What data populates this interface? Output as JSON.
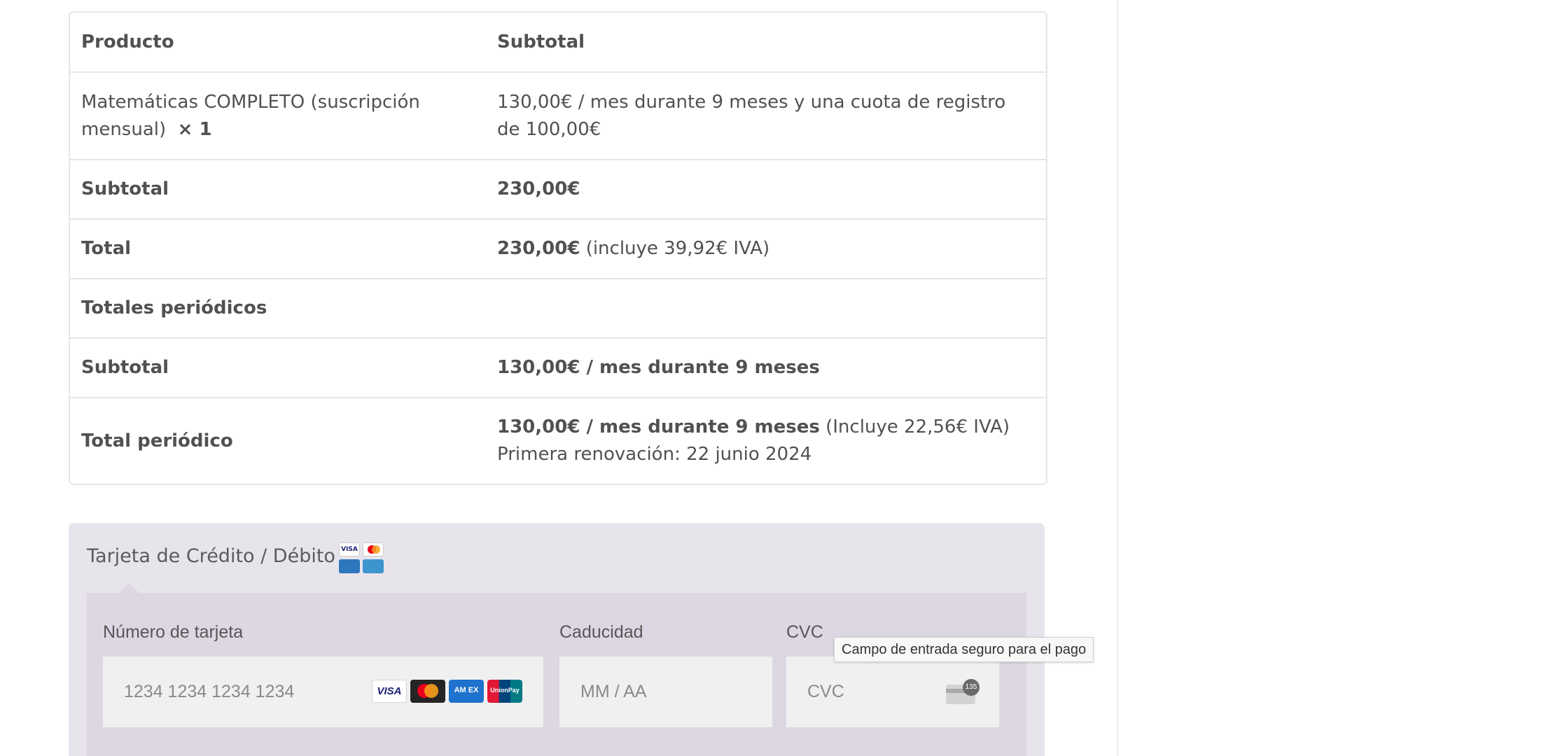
{
  "order": {
    "header": {
      "product": "Producto",
      "subtotal": "Subtotal"
    },
    "item": {
      "name": "Matemáticas COMPLETO (suscripción mensual)",
      "qty": "× 1",
      "price": "130,00€ / mes durante 9 meses y una cuota de registro de 100,00€"
    },
    "subtotal": {
      "label": "Subtotal",
      "value": "230,00€"
    },
    "total": {
      "label": "Total",
      "value": "230,00€",
      "tax": "(incluye 39,92€ IVA)"
    },
    "recurring_heading": "Totales periódicos",
    "recurring_subtotal": {
      "label": "Subtotal",
      "value": "130,00€ / mes durante 9 meses"
    },
    "recurring_total": {
      "label": "Total periódico",
      "value": "130,00€ / mes durante 9 meses",
      "tax": "(Incluye 22,56€ IVA)",
      "renewal": "Primera renovación: 22 junio 2024"
    }
  },
  "payment": {
    "method_title": "Tarjeta de Crédito / Débito",
    "method_logos": {
      "visa": "VISA"
    },
    "card_number": {
      "label": "Número de tarjeta",
      "placeholder": "1234 1234 1234 1234"
    },
    "expiry": {
      "label": "Caducidad",
      "placeholder": "MM / AA"
    },
    "cvc": {
      "label": "CVC",
      "placeholder": "CVC",
      "badge": "135"
    },
    "brands": {
      "visa": "VISA",
      "amex": "AM EX",
      "unionpay": "UnionPay"
    },
    "tooltip": "Campo de entrada seguro para el pago"
  },
  "colors": {
    "text": "#515151",
    "border": "#e6e6e6",
    "payment_bg": "#e7e4ec",
    "payment_inner_bg": "#dcd7e2",
    "field_bg": "#f0f0f0"
  }
}
